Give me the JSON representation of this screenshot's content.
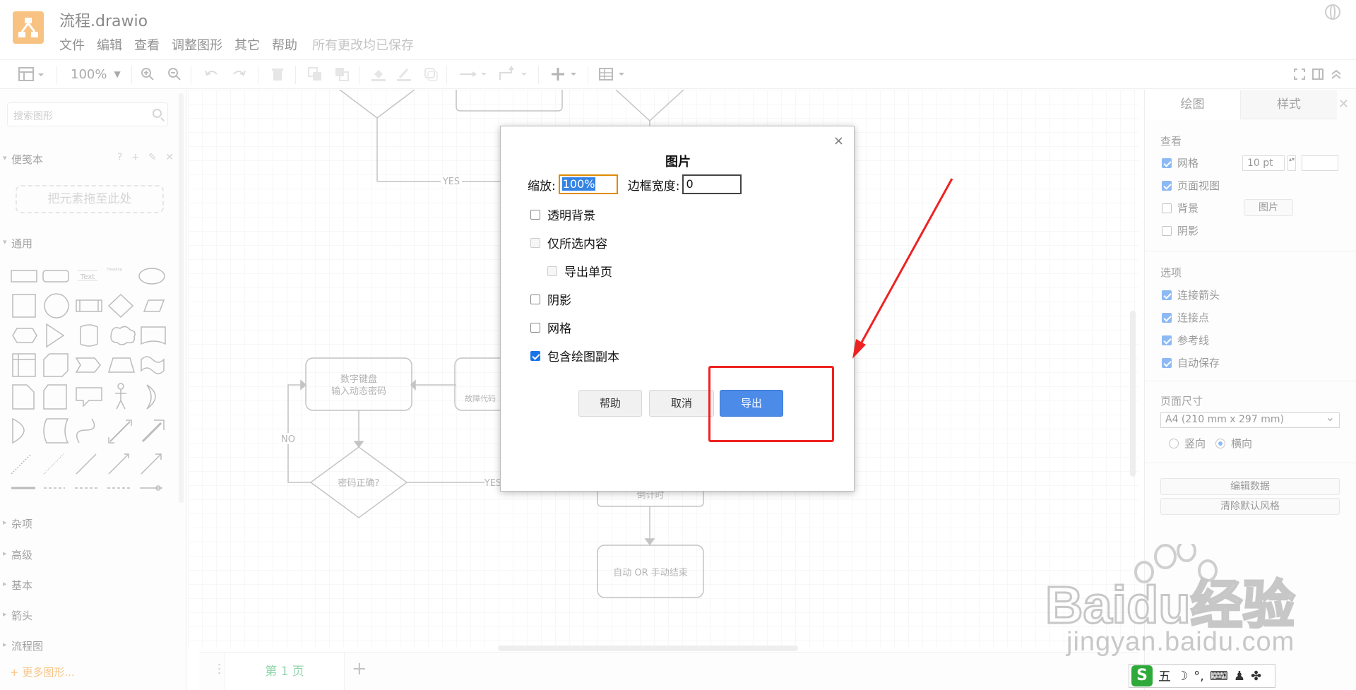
{
  "app": {
    "title": "流程.drawio",
    "menu": [
      "文件",
      "编辑",
      "查看",
      "调整图形",
      "其它",
      "帮助"
    ],
    "save_status": "所有更改均已保存"
  },
  "toolbar": {
    "zoom": "100%",
    "icons": [
      "format-panel-icon",
      "zoom-in-icon",
      "zoom-out-icon",
      "undo-icon",
      "redo-icon",
      "delete-icon",
      "to-front-icon",
      "to-back-icon",
      "fill-color-icon",
      "line-color-icon",
      "shadow-icon",
      "connection-icon",
      "waypoints-icon",
      "insert-icon",
      "table-icon",
      "fullscreen-icon",
      "format-toggle-icon",
      "collapse-icon"
    ]
  },
  "sidebar": {
    "search_placeholder": "搜索图形",
    "sections": [
      {
        "label": "便笺本",
        "open": true
      },
      {
        "label": "通用",
        "open": true
      },
      {
        "label": "杂项",
        "open": false
      },
      {
        "label": "高级",
        "open": false
      },
      {
        "label": "基本",
        "open": false
      },
      {
        "label": "箭头",
        "open": false
      },
      {
        "label": "流程图",
        "open": false
      }
    ],
    "scratch_tools": "? + ✎ ✕",
    "scratch_drop": "把元素拖至此处",
    "text_shape": "Text",
    "heading_shape": "Heading",
    "more_shapes": "+ 更多图形..."
  },
  "canvas": {
    "nodes": {
      "numpad": "数字键盘\n输入动态密码",
      "fault": "故障代码",
      "password_check": "密码正确?",
      "unlock": "倒计时",
      "finish": "自动 OR 手动结束"
    },
    "edge_labels": {
      "yes1": "YES",
      "no": "NO",
      "yes2": "YES"
    }
  },
  "pagebar": {
    "tab": "第 1 页",
    "add": "+"
  },
  "right_panel": {
    "tabs": [
      "绘图",
      "样式"
    ],
    "view_title": "查看",
    "grid_label": "网格",
    "grid_checked": true,
    "grid_size": "10 pt",
    "grid_color": "#ffffff",
    "page_view_label": "页面视图",
    "page_view_checked": true,
    "background_label": "背景",
    "background_checked": false,
    "image_button": "图片",
    "shadow_label": "阴影",
    "shadow_checked": false,
    "options_title": "选项",
    "options": [
      {
        "label": "连接箭头",
        "checked": true
      },
      {
        "label": "连接点",
        "checked": true
      },
      {
        "label": "参考线",
        "checked": true
      },
      {
        "label": "自动保存",
        "checked": true
      }
    ],
    "page_size_title": "页面尺寸",
    "page_size": "A4 (210 mm x 297 mm)",
    "orientation": {
      "portrait": "竖向",
      "landscape": "横向",
      "selected": "landscape"
    },
    "edit_data": "编辑数据",
    "clear_style": "清除默认风格"
  },
  "dialog": {
    "title": "图片",
    "close": "×",
    "zoom_label": "缩放:",
    "zoom_value": "100%",
    "border_label": "边框宽度:",
    "border_value": "0",
    "options": [
      {
        "label": "透明背景",
        "checked": false,
        "disabled": false
      },
      {
        "label": "仅所选内容",
        "checked": false,
        "disabled": true
      },
      {
        "label": "导出单页",
        "checked": false,
        "disabled": true
      },
      {
        "label": "阴影",
        "checked": false,
        "disabled": false
      },
      {
        "label": "网格",
        "checked": false,
        "disabled": false
      },
      {
        "label": "包含绘图副本",
        "checked": true,
        "disabled": false
      }
    ],
    "buttons": {
      "help": "帮助",
      "cancel": "取消",
      "export": "导出"
    }
  },
  "annotation": {
    "color": "#ee2222"
  },
  "watermark": {
    "text": "jingyan.baidu.com",
    "brand": "Baidu经验"
  },
  "ime": {
    "logo": "S",
    "mode": "五"
  },
  "colors": {
    "accent": "#f08705",
    "primary_button": "#4c8be8",
    "checkbox": "#1a73e8"
  }
}
